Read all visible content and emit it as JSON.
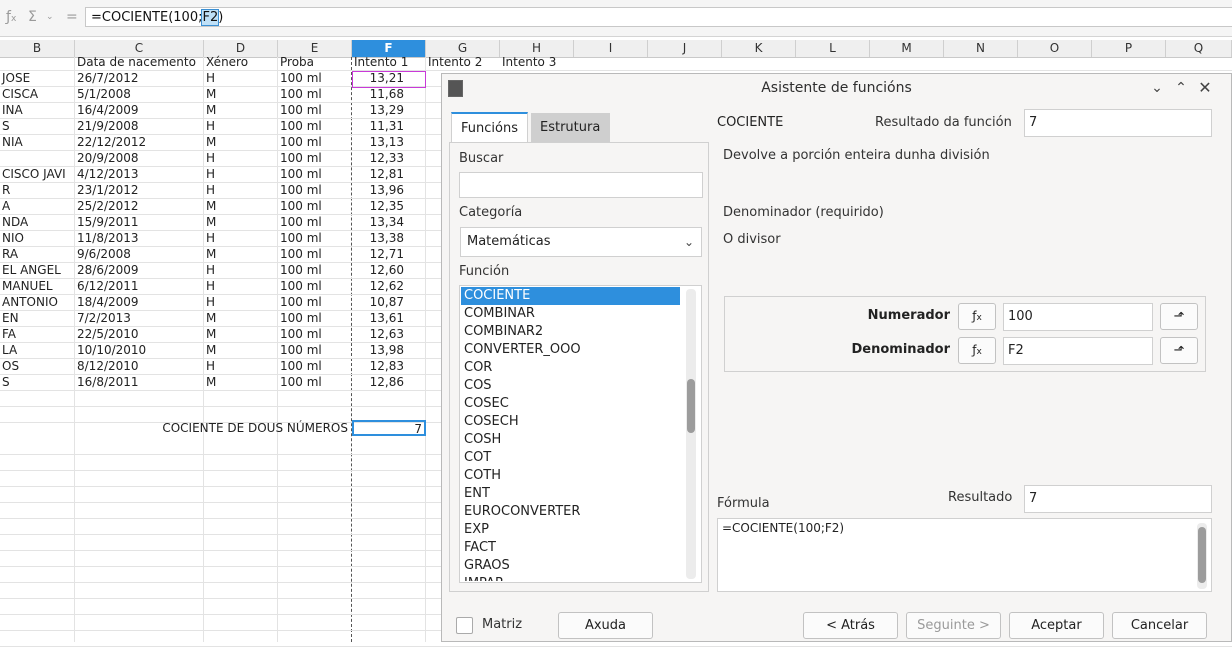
{
  "formula_bar": {
    "fx_icon": "fx-icon",
    "sum_icon": "sum-icon",
    "equals_icon": "equals-icon",
    "formula_prefix": "=COCIENTE(100;",
    "formula_highlight": "F2",
    "formula_suffix": ")"
  },
  "columns": [
    "B",
    "C",
    "D",
    "E",
    "F",
    "G",
    "H",
    "I",
    "J",
    "K",
    "L",
    "M",
    "N",
    "O",
    "P",
    "Q"
  ],
  "header_row": {
    "C": "Data de nacemento",
    "D": "Xénero",
    "E": "Proba",
    "F": "Intento 1",
    "G": "Intento 2",
    "H": "Intento 3"
  },
  "rows": [
    {
      "B": "JOSE",
      "C": "26/7/2012",
      "D": "H",
      "E": "100 ml",
      "F": "13,21"
    },
    {
      "B": "CISCA",
      "C": "5/1/2008",
      "D": "M",
      "E": "100 ml",
      "F": "11,68"
    },
    {
      "B": "INA",
      "C": "16/4/2009",
      "D": "M",
      "E": "100 ml",
      "F": "13,29"
    },
    {
      "B": "S",
      "C": "21/9/2008",
      "D": "H",
      "E": "100 ml",
      "F": "11,31"
    },
    {
      "B": "NIA",
      "C": "22/12/2012",
      "D": "M",
      "E": "100 ml",
      "F": "13,13"
    },
    {
      "B": "",
      "C": "20/9/2008",
      "D": "H",
      "E": "100 ml",
      "F": "12,33"
    },
    {
      "B": "CISCO JAVI",
      "C": "4/12/2013",
      "D": "H",
      "E": "100 ml",
      "F": "12,81"
    },
    {
      "B": "R",
      "C": "23/1/2012",
      "D": "H",
      "E": "100 ml",
      "F": "13,96"
    },
    {
      "B": "A",
      "C": "25/2/2012",
      "D": "M",
      "E": "100 ml",
      "F": "12,35"
    },
    {
      "B": "NDA",
      "C": "15/9/2011",
      "D": "M",
      "E": "100 ml",
      "F": "13,34"
    },
    {
      "B": "NIO",
      "C": "11/8/2013",
      "D": "H",
      "E": "100 ml",
      "F": "13,38"
    },
    {
      "B": "RA",
      "C": "9/6/2008",
      "D": "M",
      "E": "100 ml",
      "F": "12,71"
    },
    {
      "B": "EL ANGEL",
      "C": "28/6/2009",
      "D": "H",
      "E": "100 ml",
      "F": "12,60"
    },
    {
      "B": "MANUEL",
      "C": "6/12/2011",
      "D": "H",
      "E": "100 ml",
      "F": "12,62"
    },
    {
      "B": "ANTONIO",
      "C": "18/4/2009",
      "D": "H",
      "E": "100 ml",
      "F": "10,87"
    },
    {
      "B": "EN",
      "C": "7/2/2013",
      "D": "M",
      "E": "100 ml",
      "F": "13,61"
    },
    {
      "B": "FA",
      "C": "22/5/2010",
      "D": "M",
      "E": "100 ml",
      "F": "12,63"
    },
    {
      "B": "LA",
      "C": "10/10/2010",
      "D": "M",
      "E": "100 ml",
      "F": "13,98"
    },
    {
      "B": "OS",
      "C": "8/12/2010",
      "D": "H",
      "E": "100 ml",
      "F": "12,83"
    },
    {
      "B": "S",
      "C": "16/8/2011",
      "D": "M",
      "E": "100 ml",
      "F": "12,86"
    }
  ],
  "quotient_row": {
    "label": "COCIENTE DE DOUS NÚMEROS",
    "value": "7"
  },
  "dialog": {
    "title": "Asistente de funcións",
    "tabs": [
      "Funcións",
      "Estrutura"
    ],
    "search_label": "Buscar",
    "category_label": "Categoría",
    "category_value": "Matemáticas",
    "function_label": "Función",
    "functions": [
      "COCIENTE",
      "COMBINAR",
      "COMBINAR2",
      "CONVERTER_OOO",
      "COR",
      "COS",
      "COSEC",
      "COSECH",
      "COSH",
      "COT",
      "COTH",
      "ENT",
      "EUROCONVERTER",
      "EXP",
      "FACT",
      "GRAOS",
      "IMPAR"
    ],
    "selected_function": "COCIENTE",
    "function_name": "COCIENTE",
    "function_result_label": "Resultado da función",
    "function_result": "7",
    "description": "Devolve a porción enteira dunha división",
    "arg_title": "Denominador (requirido)",
    "arg_desc": "O divisor",
    "args": [
      {
        "label": "Numerador",
        "value": "100"
      },
      {
        "label": "Denominador",
        "value": "F2"
      }
    ],
    "formula_label": "Fórmula",
    "result_label": "Resultado",
    "result_value": "7",
    "formula_text": "=COCIENTE(100;F2)",
    "matrix_label": "Matriz",
    "buttons": {
      "help": "Axuda",
      "back": "< Atrás",
      "next": "Seguinte >",
      "ok": "Aceptar",
      "cancel": "Cancelar"
    }
  }
}
